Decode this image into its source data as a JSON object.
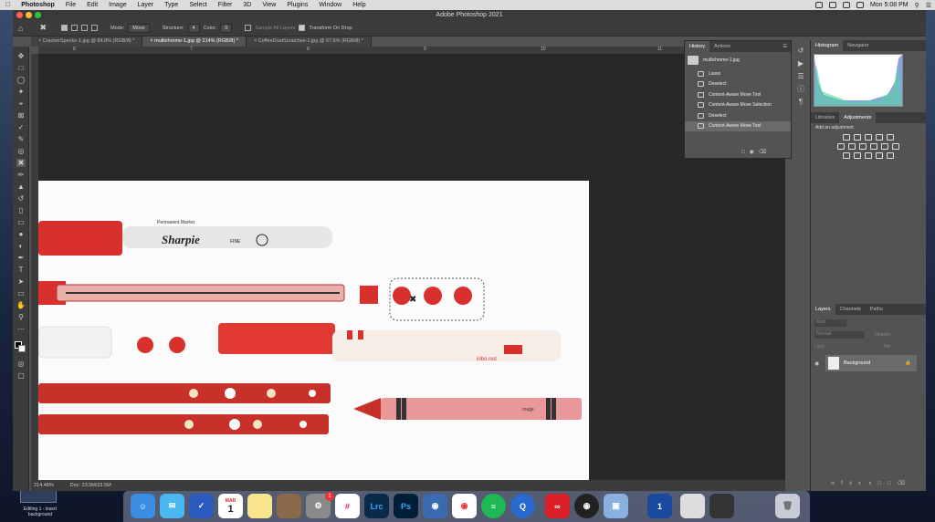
{
  "menubar": {
    "app": "Photoshop",
    "items": [
      "File",
      "Edit",
      "Image",
      "Layer",
      "Type",
      "Select",
      "Filter",
      "3D",
      "View",
      "Plugins",
      "Window",
      "Help"
    ],
    "clock": "Mon 5:08 PM"
  },
  "window": {
    "title": "Adobe Photoshop 2021"
  },
  "options": {
    "mode_label": "Mode:",
    "mode_value": "Move",
    "structure_label": "Structure:",
    "structure_value": "4",
    "color_label": "Color:",
    "color_value": "0",
    "sample_label": "Sample All Layers",
    "transform_label": "Transform On Drop"
  },
  "tabs": [
    {
      "label": "CrackerSpecks-1.jpg @ 84.8% (RGB/8) *"
    },
    {
      "label": "multichrome-1.jpg @ 214% (RGB/8) *"
    },
    {
      "label": "CoffeeDustScratches-1.jpg @ 67.6% (RGB/8) *"
    }
  ],
  "rulers": {
    "top": [
      "6",
      "7",
      "8",
      "9",
      "10",
      "11"
    ]
  },
  "status": {
    "zoom": "214.48%",
    "doc": "Doc: 23.5M/23.5M"
  },
  "history": {
    "tab_history": "History",
    "tab_actions": "Actions",
    "snapshot": "multichrome-1.jpg",
    "items": [
      "Lasso",
      "Deselect",
      "Content-Aware Move Tool",
      "Content-Aware Move Selection",
      "Deselect",
      "Content-Aware Move Tool"
    ]
  },
  "histogram_panel": {
    "tab1": "Histogram",
    "tab2": "Navigator"
  },
  "adjust_panel": {
    "tab1": "Libraries",
    "tab2": "Adjustments",
    "add_label": "Add an adjustment"
  },
  "layers_panel": {
    "tab1": "Layers",
    "tab2": "Channels",
    "tab3": "Paths",
    "kind": "Kind",
    "blend": "Normal",
    "opacity_label": "Opacity:",
    "fill_label": "Fill:",
    "lock_label": "Lock:",
    "layer_name": "Background"
  },
  "artwork": {
    "sharpie_brand": "Sharpie",
    "sharpie_sub": "Permanent Marker",
    "sharpie_fine": "FINE",
    "marker_label": "inbo red",
    "crayon_label": "rouge"
  },
  "desktop": {
    "widget_text1": "Editing 1 - insert",
    "widget_text2": "background"
  },
  "dock": {
    "badge": "1",
    "icons": [
      "finder-icon",
      "messages-icon",
      "reminders-icon",
      "calendar-icon",
      "notes-icon",
      "stickies-icon",
      "system-prefs-icon",
      "slack-icon",
      "lightroom-icon",
      "photoshop-icon",
      "network-icon",
      "chrome-icon",
      "spotify-icon",
      "quicktime-icon",
      "creative-cloud-icon",
      "obs-icon",
      "preview-icon",
      "onepassword-icon",
      "window-icon",
      "screen-icon",
      "trash-icon"
    ],
    "calendar_month": "MAR",
    "calendar_day": "1",
    "lrc": "Lrc",
    "ps": "Ps"
  }
}
